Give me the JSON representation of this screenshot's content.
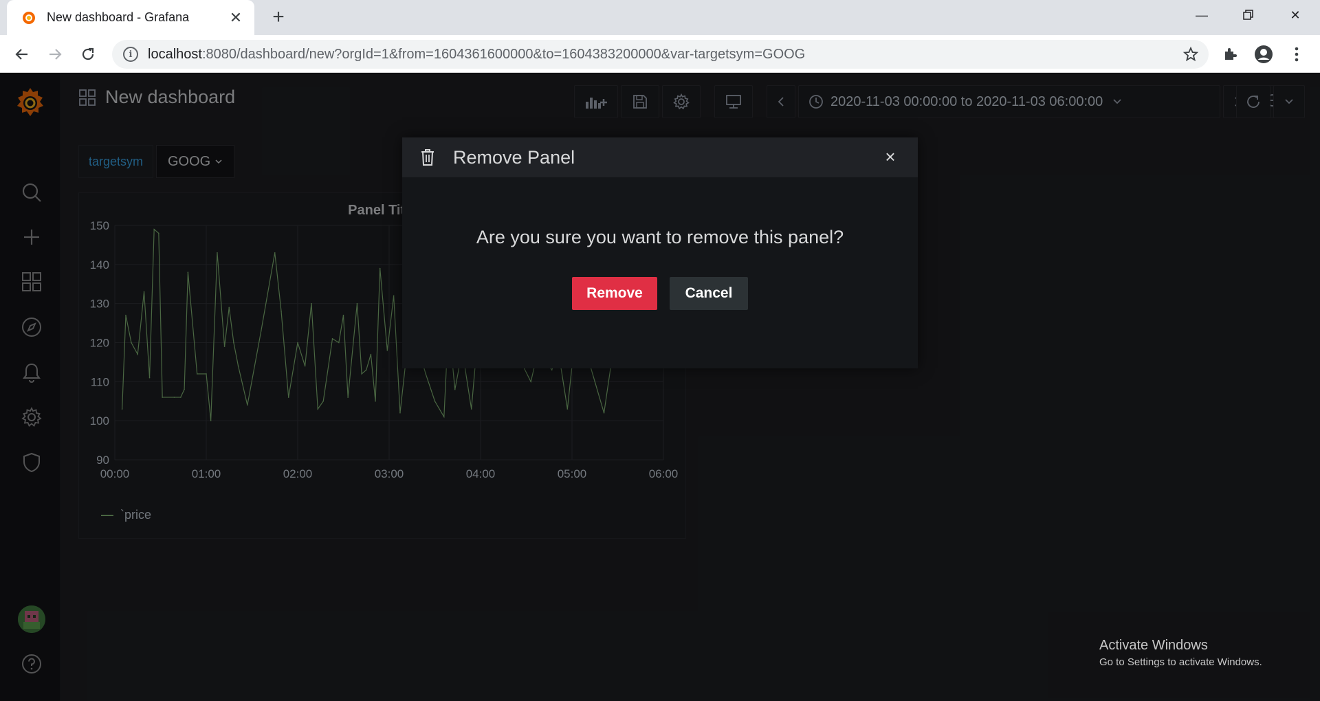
{
  "browser": {
    "tab_title": "New dashboard - Grafana",
    "url_host": "localhost",
    "url_rest": ":8080/dashboard/new?orgId=1&from=1604361600000&to=1604383200000&var-targetsym=GOOG"
  },
  "dashboard": {
    "title": "New dashboard",
    "time_range": "2020-11-03 00:00:00 to 2020-11-03 06:00:00"
  },
  "variables": {
    "label": "targetsym",
    "value": "GOOG"
  },
  "panel": {
    "title": "Panel Title",
    "legend": "`price"
  },
  "chart_data": {
    "type": "line",
    "title": "Panel Title",
    "ylim": [
      90,
      150
    ],
    "y_ticks": [
      "150",
      "140",
      "130",
      "120",
      "110",
      "100",
      "90"
    ],
    "x_ticks": [
      "00:00",
      "01:00",
      "02:00",
      "03:00",
      "04:00",
      "05:00",
      "06:00"
    ],
    "series": [
      {
        "name": "`price",
        "color": "#7eb26d",
        "x_hours": [
          0.08,
          0.12,
          0.18,
          0.25,
          0.32,
          0.38,
          0.43,
          0.48,
          0.52,
          0.65,
          0.72,
          0.76,
          0.8,
          0.9,
          1.0,
          1.05,
          1.12,
          1.2,
          1.25,
          1.3,
          1.35,
          1.45,
          1.6,
          1.75,
          1.82,
          1.9,
          2.0,
          2.08,
          2.15,
          2.22,
          2.28,
          2.38,
          2.45,
          2.5,
          2.55,
          2.65,
          2.7,
          2.75,
          2.8,
          2.85,
          2.9,
          2.98,
          3.05,
          3.12,
          3.2,
          3.28,
          3.35,
          3.4,
          3.5,
          3.6,
          3.65,
          3.72,
          3.8,
          3.9,
          4.0,
          4.1,
          4.2,
          4.3,
          4.4,
          4.55,
          4.65,
          4.72,
          4.78,
          4.85,
          4.95,
          5.05,
          5.15,
          5.25,
          5.35,
          5.45,
          5.55,
          5.65
        ],
        "values": [
          103,
          127,
          120,
          117,
          133,
          111,
          149,
          148,
          106,
          106,
          106,
          108,
          138,
          112,
          112,
          100,
          143,
          119,
          129,
          120,
          114,
          104,
          123,
          143,
          128,
          106,
          120,
          114,
          130,
          103,
          105,
          121,
          120,
          127,
          106,
          130,
          112,
          113,
          117,
          105,
          139,
          118,
          132,
          102,
          119,
          138,
          116,
          112,
          105,
          101,
          125,
          108,
          118,
          103,
          130,
          115,
          127,
          120,
          117,
          110,
          120,
          115,
          113,
          118,
          103,
          125,
          118,
          110,
          102,
          118,
          128,
          115
        ]
      }
    ]
  },
  "modal": {
    "title": "Remove Panel",
    "question": "Are you sure you want to remove this panel?",
    "confirm_label": "Remove",
    "cancel_label": "Cancel"
  },
  "watermark": {
    "title": "Activate Windows",
    "subtitle": "Go to Settings to activate Windows."
  }
}
